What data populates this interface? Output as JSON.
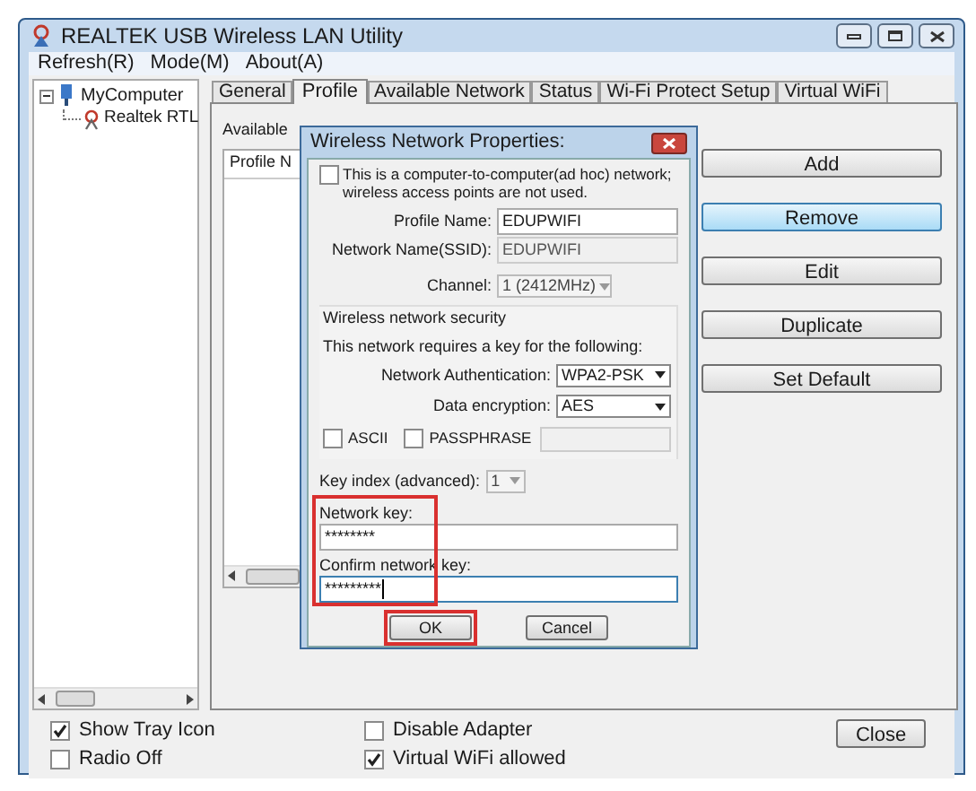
{
  "window": {
    "title": "REALTEK USB Wireless LAN Utility"
  },
  "menu": [
    {
      "label": "Refresh(R)"
    },
    {
      "label": "Mode(M)"
    },
    {
      "label": "About(A)"
    }
  ],
  "tree": [
    {
      "label": "MyComputer",
      "expanded": true,
      "children": [
        {
          "label": "Realtek RTL"
        }
      ]
    }
  ],
  "tabs": [
    {
      "label": "General",
      "selected": false
    },
    {
      "label": "Profile",
      "selected": true
    },
    {
      "label": "Available Network",
      "selected": false
    },
    {
      "label": "Status",
      "selected": false
    },
    {
      "label": "Wi-Fi Protect Setup",
      "selected": false
    },
    {
      "label": "Virtual WiFi",
      "selected": false
    }
  ],
  "profile_page": {
    "list_label": "Available",
    "list_column": "Profile N",
    "buttons": [
      {
        "label": "Add",
        "focused": false
      },
      {
        "label": "Remove",
        "focused": true
      },
      {
        "label": "Edit",
        "focused": false
      },
      {
        "label": "Duplicate",
        "focused": false
      },
      {
        "label": "Set Default",
        "focused": false
      }
    ]
  },
  "dialog": {
    "title": "Wireless Network Properties:",
    "adhoc": {
      "label": "This is a computer-to-computer(ad hoc) network; wireless access points are not used.",
      "checked": false
    },
    "fields": [
      {
        "label": "Profile Name:",
        "value": "EDUPWIFI",
        "disabled": false
      },
      {
        "label": "Network Name(SSID):",
        "value": "EDUPWIFI",
        "disabled": true
      }
    ],
    "channel": {
      "label": "Channel:",
      "value": "1 (2412MHz)",
      "disabled": true
    },
    "security": {
      "title": "Wireless network security",
      "note": "This network requires a key for the following:",
      "authentication": {
        "label": "Network Authentication:",
        "value": "WPA2-PSK"
      },
      "encryption": {
        "label": "Data encryption:",
        "value": "AES"
      },
      "ascii": {
        "label": "ASCII",
        "checked": false
      },
      "passphrase": {
        "label": "PASSPHRASE",
        "checked": false
      }
    },
    "key_index": {
      "label": "Key index (advanced):",
      "value": "1"
    },
    "keys": {
      "highlighted": true,
      "fields": [
        {
          "label": "Network key:",
          "value": "********",
          "focused": false
        },
        {
          "label": "Confirm network key:",
          "value": "*********",
          "focused": true
        }
      ]
    },
    "buttons": [
      {
        "label": "OK",
        "highlighted": true
      },
      {
        "label": "Cancel",
        "highlighted": false
      }
    ]
  },
  "options": [
    {
      "label": "Show Tray Icon",
      "checked": true
    },
    {
      "label": "Radio Off",
      "checked": false
    },
    {
      "label": "Disable Adapter",
      "checked": false
    },
    {
      "label": "Virtual WiFi allowed",
      "checked": true
    }
  ],
  "close_button": "Close"
}
